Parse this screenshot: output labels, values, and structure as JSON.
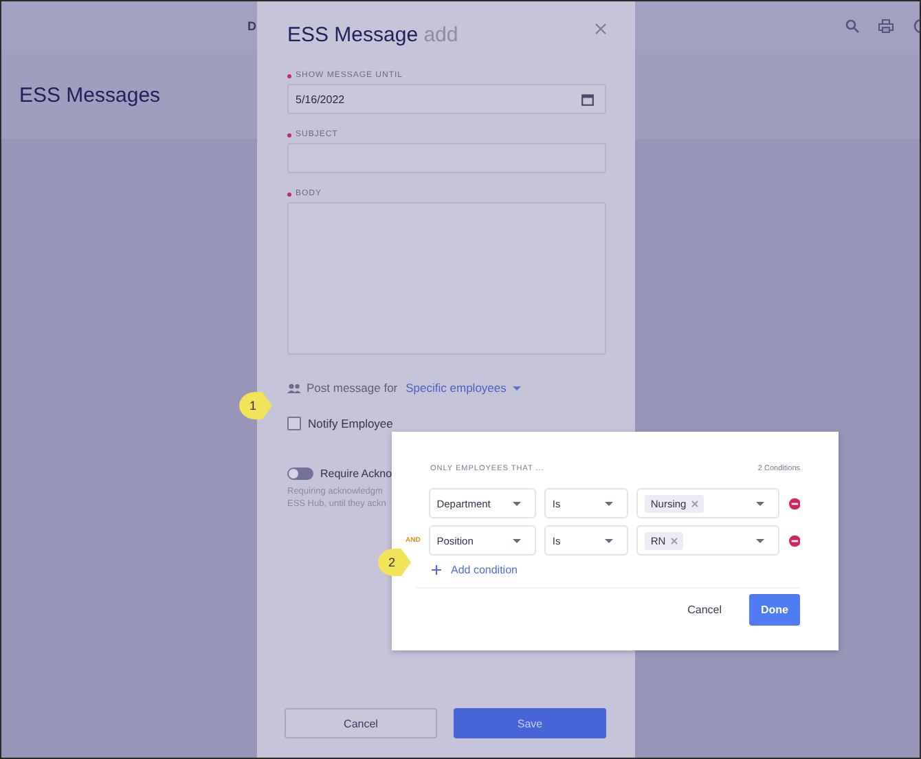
{
  "header": {
    "nav_text": "D"
  },
  "page_title": "ESS Messages",
  "modal": {
    "title": "ESS Message",
    "subtitle": "add",
    "fields": [
      {
        "kind": "date",
        "label": "SHOW MESSAGE UNTIL",
        "required": true,
        "value": "5/16/2022"
      },
      {
        "kind": "text",
        "label": "SUBJECT",
        "required": true
      },
      {
        "kind": "textarea",
        "label": "BODY",
        "required": true
      }
    ],
    "audience": {
      "label": "Post message for",
      "value": "Specific employees"
    },
    "notify": {
      "label": "Notify Employee",
      "checked": false
    },
    "acknowledge": {
      "label": "Require Ackno",
      "on": false,
      "help": [
        "Requiring acknowledgm",
        "ESS Hub, until they ackn"
      ]
    },
    "buttons": [
      {
        "kind": "secondary",
        "label": "Cancel"
      },
      {
        "kind": "primary",
        "label": "Save"
      }
    ]
  },
  "popup": {
    "heading": "ONLY EMPLOYEES THAT ...",
    "count": "2 Conditions",
    "conditions": [
      {
        "field": "Department",
        "operator": "Is",
        "values": [
          "Nursing"
        ]
      },
      {
        "conjunction": "AND",
        "field": "Position",
        "operator": "Is",
        "values": [
          "RN"
        ]
      }
    ],
    "add_label": "Add condition",
    "buttons": [
      {
        "kind": "secondary",
        "label": "Cancel"
      },
      {
        "kind": "primary",
        "label": "Done"
      }
    ]
  },
  "callouts": [
    {
      "number": "1"
    },
    {
      "number": "2"
    }
  ]
}
